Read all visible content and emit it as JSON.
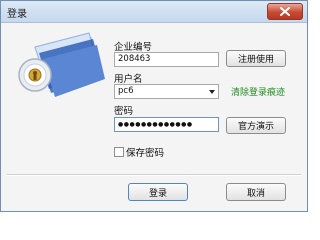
{
  "window": {
    "title": "登录"
  },
  "form": {
    "company_label": "企业编号",
    "company_value": "208463",
    "user_label": "用户名",
    "user_value": "pc6",
    "password_label": "密码",
    "password_value": "●●●●●●●●●●●●●",
    "save_password_label": "保存密码",
    "save_password_checked": false
  },
  "buttons": {
    "register": "注册使用",
    "clear_history": "清除登录痕迹",
    "demo": "官方演示",
    "login": "登录",
    "cancel": "取消"
  },
  "icons": {
    "illustration": "key-lock-folder-icon",
    "close": "close-icon",
    "dropdown": "chevron-down-icon"
  },
  "colors": {
    "link_green": "#1e8a1e",
    "default_button_border": "#4f86c6",
    "close_button": "#c74a33"
  }
}
